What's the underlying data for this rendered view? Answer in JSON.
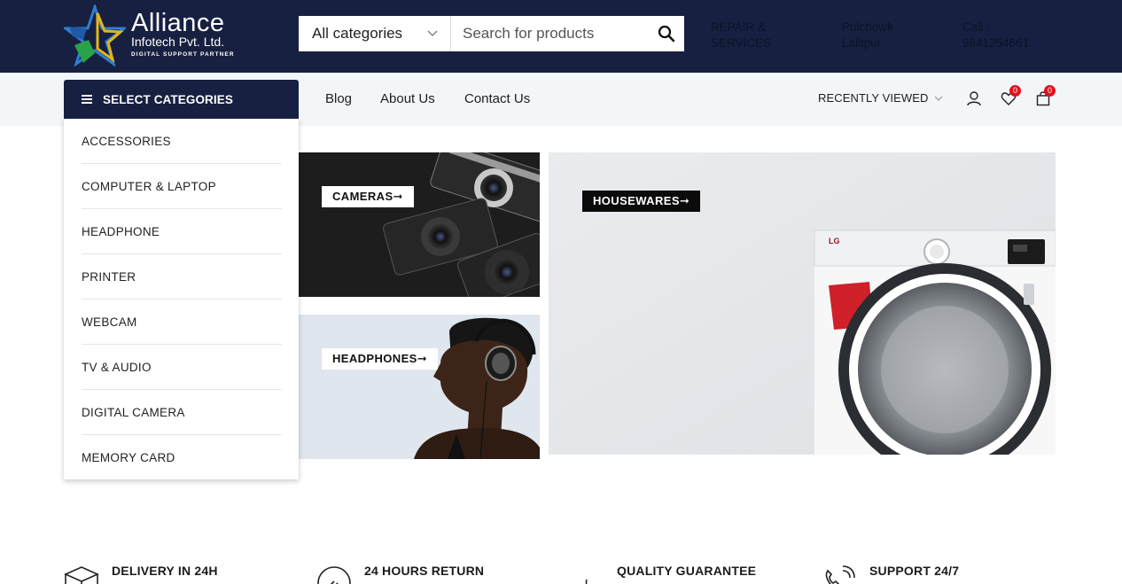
{
  "header": {
    "logo_title": "Alliance",
    "logo_subtitle": "Infotech Pvt. Ltd.",
    "logo_tagline": "DIGITAL SUPPORT PARTNER",
    "search": {
      "category_label": "All categories",
      "placeholder": "Search for products"
    },
    "info": [
      {
        "line1": "REPAIR &",
        "line2": "SERVICES"
      },
      {
        "line1": "Pulchowk",
        "line2": "Lalitpur"
      },
      {
        "line1": "Call :",
        "line2": "9841254661"
      }
    ]
  },
  "nav": {
    "categories_button": "SELECT CATEGORIES",
    "links": [
      "Blog",
      "About Us",
      "Contact Us"
    ],
    "recently_viewed": "RECENTLY VIEWED",
    "wishlist_count": "0",
    "cart_count": "0"
  },
  "categories": [
    "ACCESSORIES",
    "COMPUTER & LAPTOP",
    "HEADPHONE",
    "PRINTER",
    "WEBCAM",
    "TV & AUDIO",
    "DIGITAL CAMERA",
    "MEMORY CARD"
  ],
  "banners": {
    "cameras": "CAMERAS➞",
    "headphones": "HEADPHONES➞",
    "housewares": "HOUSEWARES➞",
    "washer_brand": "LG"
  },
  "features": [
    {
      "title": "DELIVERY IN 24H",
      "icon": "delivery-box-icon"
    },
    {
      "title": "24 HOURS RETURN",
      "icon": "return-icon"
    },
    {
      "title": "QUALITY GUARANTEE",
      "icon": "quality-icon"
    },
    {
      "title": "SUPPORT 24/7",
      "icon": "phone-support-icon"
    }
  ],
  "colors": {
    "header_bg": "#172040",
    "nav_bg": "#f3f6f9",
    "badge": "#e3101e"
  }
}
